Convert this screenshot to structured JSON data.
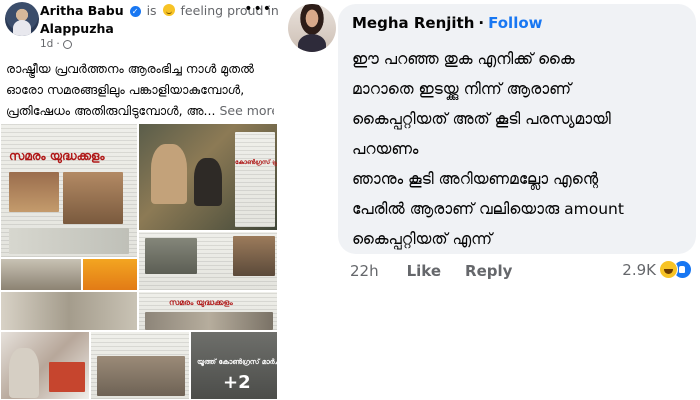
{
  "post": {
    "author": "Aritha Babu",
    "verb": "is",
    "feeling": "feeling proud in",
    "location": "Alappuzha",
    "time": "1d",
    "text_lines": [
      "രാഷ്ട്രീയ പ്രവർത്തനം ആരംഭിച്ച നാൾ മുതൽ",
      "ഓരോ സമരങ്ങളിലും പങ്കാളിയാകുമ്പോൾ,",
      "പ്രതിഷേധം അതിരുവിടുമ്പോൾ, അ..."
    ],
    "see_more": "See more",
    "more_icon": "more-options-icon",
    "grid": {
      "headline_1": "സമരം യുദ്ധക്കളം",
      "headline_2": "കോൺഗ്രസ് പ്രതിഷേധം",
      "headline_3": "സമരം യുദ്ധക്കളം",
      "headline_4": "യൂത്ത് കോൺഗ്രസ് മാർച്ചിൽ സംഘർഷം",
      "extra_count": "+2"
    }
  },
  "comment": {
    "author": "Megha Renjith",
    "separator": "·",
    "follow": "Follow",
    "lines": [
      "ഈ പറഞ്ഞ തുക എനിക്ക് കൈ",
      "മാറാതെ ഇടയ്ക്കു നിന്ന് ആരാണ്",
      "കൈപ്പറ്റിയത് അത് കൂടി പരസ്യമായി",
      "പറയണം",
      "ഞാനും കൂടി അറിയണമല്ലോ എന്റെ",
      "പേരിൽ ആരാണ് വലിയൊരു amount",
      "കൈപ്പറ്റിയത് എന്ന്"
    ],
    "time": "22h",
    "like": "Like",
    "reply": "Reply",
    "reaction_count": "2.9K",
    "reaction_icons": [
      "haha-icon",
      "like-icon"
    ]
  },
  "colors": {
    "accent": "#1877f2",
    "bubble": "#f0f2f5",
    "muted": "#65676b"
  }
}
